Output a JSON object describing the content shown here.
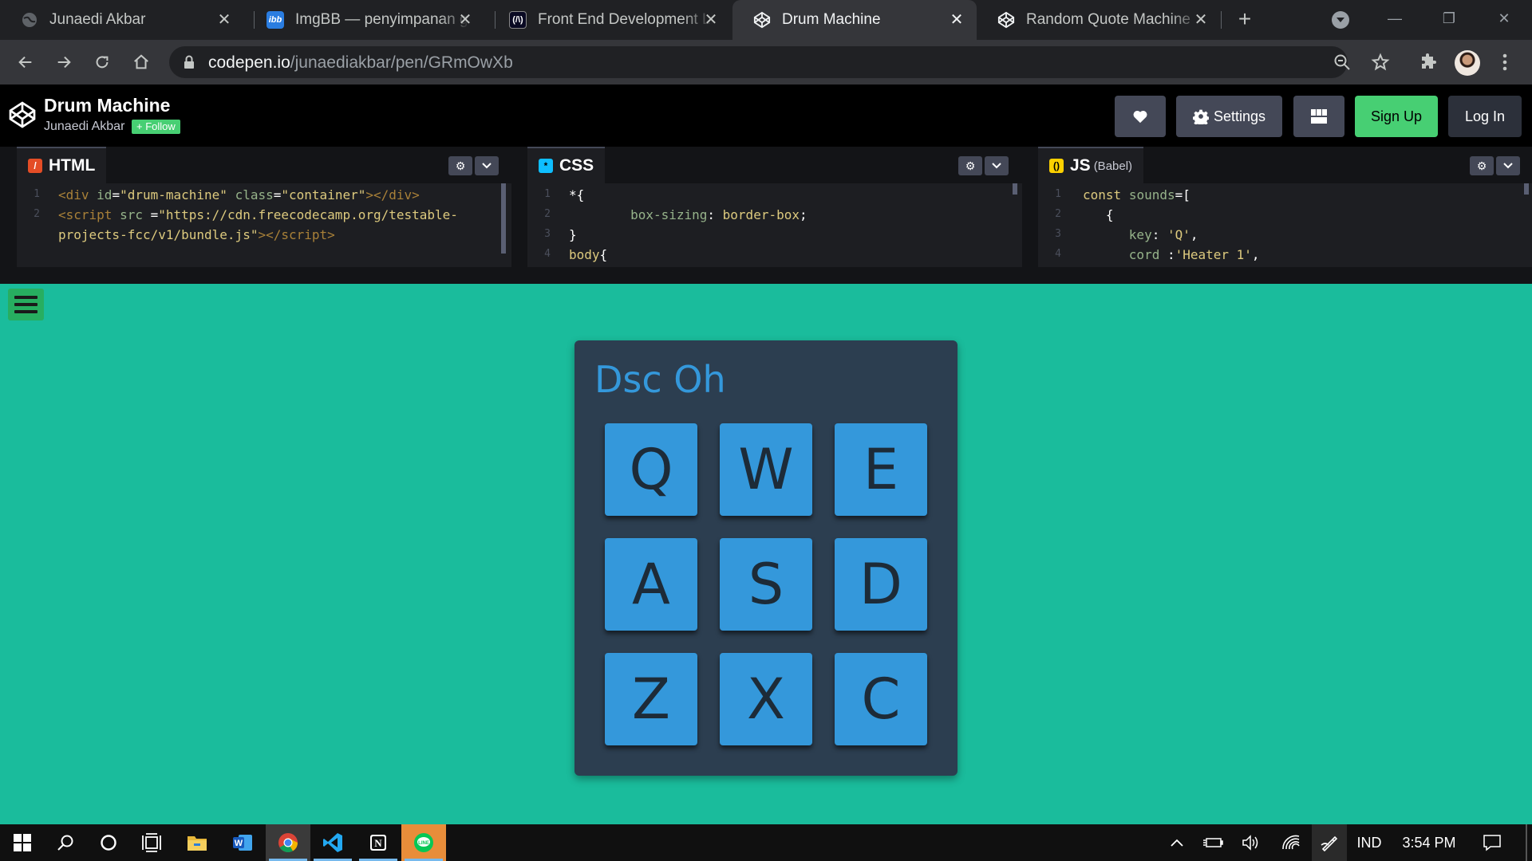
{
  "browser": {
    "tabs": [
      {
        "title": "Junaedi Akbar",
        "active": false
      },
      {
        "title": "ImgBB — penyimpanan gambar",
        "active": false
      },
      {
        "title": "Front End Development Libraries",
        "active": false
      },
      {
        "title": "Drum Machine",
        "active": true
      },
      {
        "title": "Random Quote Machine",
        "active": false
      }
    ],
    "url_host": "codepen.io",
    "url_path": "/junaediakbar/pen/GRmOwXb"
  },
  "codepen": {
    "pen_title": "Drum Machine",
    "author": "Junaedi Akbar",
    "follow_label": "+ Follow",
    "settings_label": "Settings",
    "signup_label": "Sign Up",
    "login_label": "Log In",
    "panels": [
      {
        "name": "HTML",
        "sub": ""
      },
      {
        "name": "CSS",
        "sub": ""
      },
      {
        "name": "JS",
        "sub": "(Babel)"
      }
    ]
  },
  "preview": {
    "display_text": "Dsc Oh",
    "pads": [
      "Q",
      "W",
      "E",
      "A",
      "S",
      "D",
      "Z",
      "X",
      "C"
    ],
    "colors": {
      "background": "#1abc9c",
      "machine": "#2c3e50",
      "pad": "#3498db",
      "menu": "#27ae60"
    }
  },
  "taskbar": {
    "language": "IND",
    "time": "3:54 PM"
  }
}
